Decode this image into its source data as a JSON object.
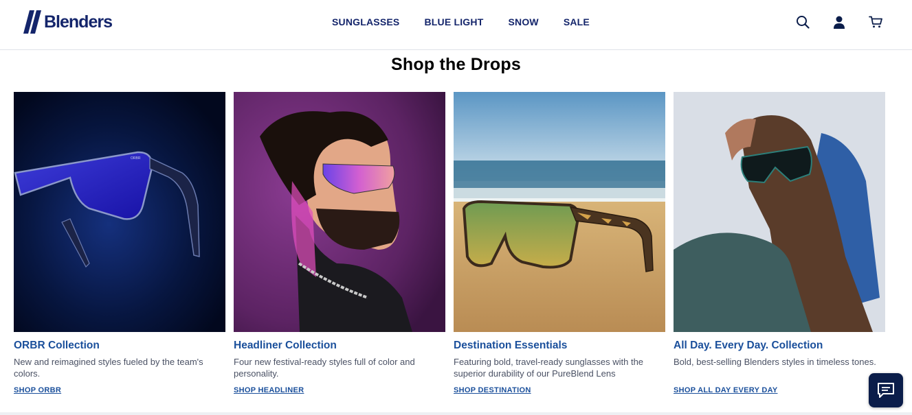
{
  "brand": {
    "name": "Blenders",
    "color": "#14256b"
  },
  "nav": {
    "items": [
      {
        "label": "SUNGLASSES"
      },
      {
        "label": "BLUE LIGHT"
      },
      {
        "label": "SNOW"
      },
      {
        "label": "SALE"
      }
    ]
  },
  "header_icons": [
    "search-icon",
    "account-icon",
    "cart-icon"
  ],
  "section": {
    "title": "Shop the Drops"
  },
  "cards": [
    {
      "image": "ORBR sunglasses on dark blue background",
      "title": "ORBR Collection",
      "description": "New and reimagined styles fueled by the team's colors.",
      "link": "SHOP ORBR"
    },
    {
      "image": "Man wearing purple shield sunglasses",
      "title": "Headliner Collection",
      "description": "Four new festival-ready styles full of color and personality.",
      "link": "SHOP HEADLINER"
    },
    {
      "image": "Tortoise shield sunglasses on beach sand",
      "title": "Destination Essentials",
      "description": "Featuring bold, travel-ready sunglasses with the superior durability of our PureBlend Lens",
      "link": "SHOP DESTINATION"
    },
    {
      "image": "Woman wearing green sunglasses against blue sky",
      "title": "All Day. Every Day. Collection",
      "description": "Bold, best-selling Blenders styles in timeless tones.",
      "link": "SHOP ALL DAY EVERY DAY"
    }
  ],
  "colors": {
    "accent": "#1a4f9b",
    "chat_button": "#0b1d4a"
  },
  "chat": {
    "icon": "chat-icon"
  }
}
